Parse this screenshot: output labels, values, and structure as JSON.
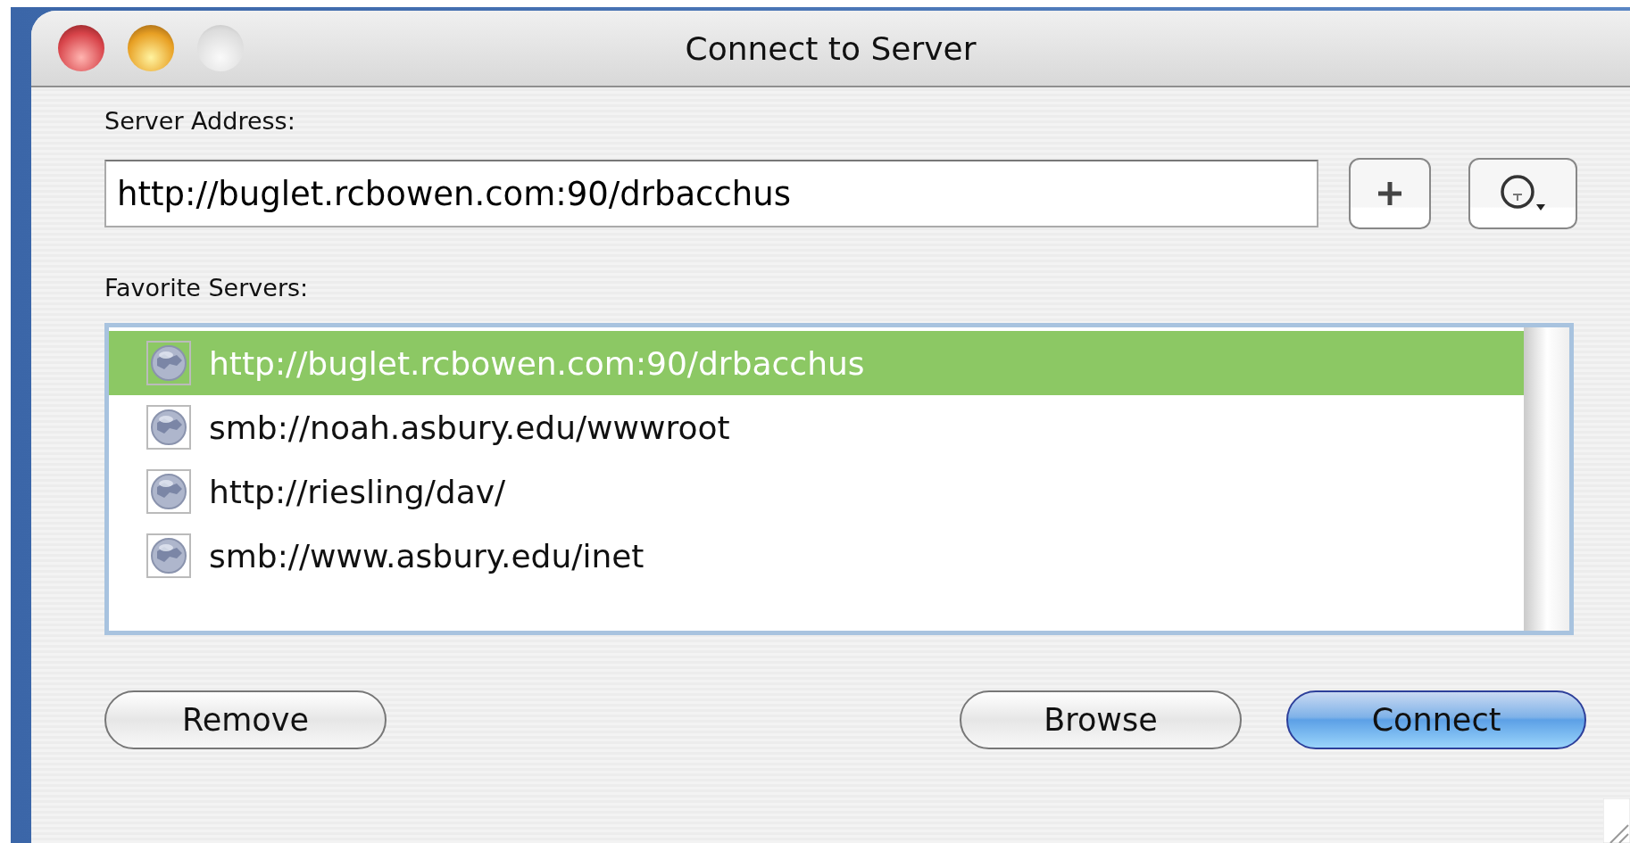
{
  "window": {
    "title": "Connect to Server"
  },
  "server_address": {
    "label": "Server Address:",
    "value": "http://buglet.rcbowen.com:90/drbacchus"
  },
  "favorites": {
    "label": "Favorite Servers:",
    "items": [
      {
        "text": "http://buglet.rcbowen.com:90/drbacchus",
        "selected": true
      },
      {
        "text": "smb://noah.asbury.edu/wwwroot",
        "selected": false
      },
      {
        "text": "http://riesling/dav/",
        "selected": false
      },
      {
        "text": "smb://www.asbury.edu/inet",
        "selected": false
      }
    ]
  },
  "buttons": [
    {
      "label": "Remove",
      "default": false,
      "kind": "left"
    },
    {
      "label": "Browse",
      "default": false,
      "kind": "right"
    },
    {
      "label": "Connect",
      "default": true,
      "kind": "right"
    }
  ]
}
